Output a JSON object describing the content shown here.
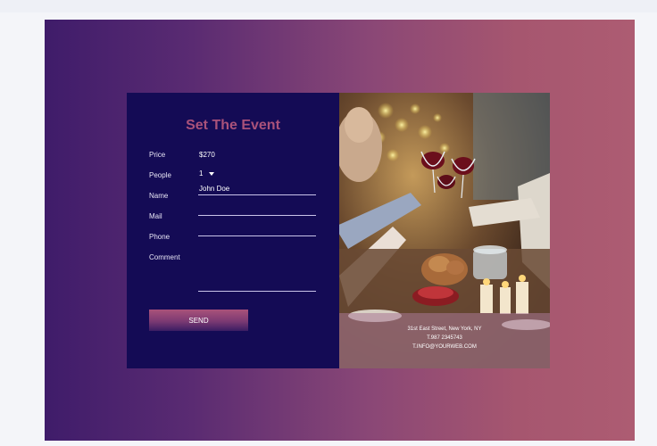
{
  "form": {
    "title": "Set The Event",
    "price_label": "Price",
    "price_value": "$270",
    "people_label": "People",
    "people_value": "1",
    "name_label": "Name",
    "name_value": "John Doe",
    "mail_label": "Mail",
    "mail_value": "",
    "phone_label": "Phone",
    "phone_value": "",
    "comment_label": "Comment",
    "comment_value": "",
    "send_label": "SEND"
  },
  "contact": {
    "address": "31st East Street, New York, NY",
    "phone": "T.987 2345743",
    "email": "T.INFO@YOURWEB.COM"
  },
  "colors": {
    "panel_bg": "#140b55",
    "title_accent": "#a9527a",
    "gradient_start": "#3f1c6a",
    "gradient_end": "#ad5c72"
  }
}
